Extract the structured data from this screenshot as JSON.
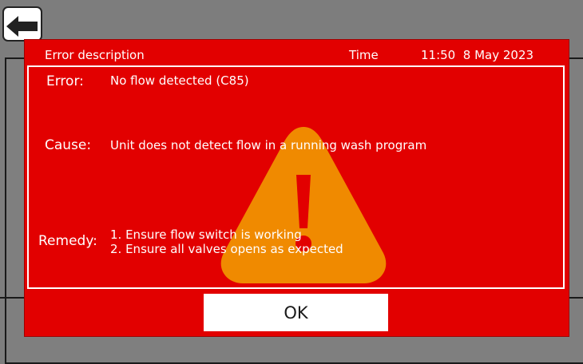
{
  "screen": {
    "back_icon": "back-arrow-icon",
    "colors": {
      "dialog_bg": "#e20000",
      "warning_icon": "#f08a00",
      "background": "#7d7d7d"
    }
  },
  "dialog": {
    "title": "Error description",
    "time_label": "Time",
    "timestamp": "11:50  8 May 2023",
    "warning_icon": "warning-triangle-icon",
    "error_label": "Error:",
    "error_value": "No flow detected (C85)",
    "cause_label": "Cause:",
    "cause_value": "Unit does not detect flow in a running wash program",
    "remedy_label": "Remedy:",
    "remedy_lines": [
      "1. Ensure flow switch is working",
      "2. Ensure all valves opens as expected"
    ],
    "ok_label": "OK"
  }
}
